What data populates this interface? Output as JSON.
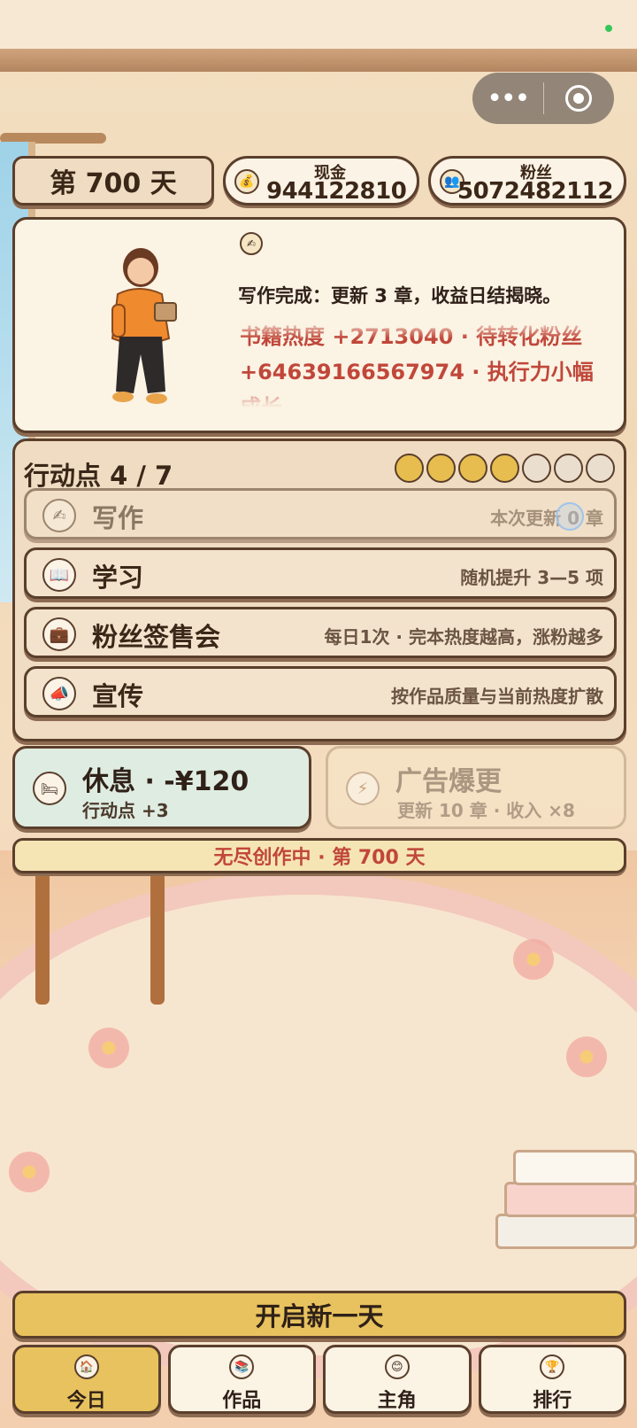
{
  "status": {
    "day_label": "第 700 天"
  },
  "stats": {
    "cash": {
      "label": "现金",
      "value": "944122810",
      "icon": "money-bag-icon"
    },
    "fans": {
      "label": "粉丝",
      "value": "5072482112",
      "icon": "people-icon"
    }
  },
  "story": {
    "icon": "quill-icon",
    "message": "写作完成：更新 3 章，收益日结揭晓。",
    "log_lines": [
      "书籍热度 +2713040 · 待转化粉丝",
      "+64639166567974 · 执行力小幅",
      "成长"
    ]
  },
  "actions": {
    "title": "行动点 4 / 7",
    "points_current": 4,
    "points_max": 7,
    "items": [
      {
        "name": "写作",
        "desc": "本次更新 0 章",
        "icon": "pen-icon",
        "enabled": false
      },
      {
        "name": "学习",
        "desc": "随机提升 3—5 项",
        "icon": "book-icon",
        "enabled": true
      },
      {
        "name": "粉丝签售会",
        "desc": "每日1次 · 完本热度越高，涨粉越多",
        "icon": "briefcase-icon",
        "enabled": true
      },
      {
        "name": "宣传",
        "desc": "按作品质量与当前热度扩散",
        "icon": "megaphone-icon",
        "enabled": true
      }
    ]
  },
  "rest": {
    "title": "休息 · -¥120",
    "subtitle": "行动点 +3",
    "icon": "bed-icon"
  },
  "ad": {
    "title": "广告爆更",
    "subtitle": "更新 10 章 · 收入 ×8",
    "icon": "lightning-icon"
  },
  "banner": {
    "text": "无尽创作中 · 第 700 天"
  },
  "new_day_button": "开启新一天",
  "tabs": [
    {
      "label": "今日",
      "icon": "house-icon",
      "active": true
    },
    {
      "label": "作品",
      "icon": "books-icon",
      "active": false
    },
    {
      "label": "主角",
      "icon": "face-icon",
      "active": false
    },
    {
      "label": "排行",
      "icon": "trophy-icon",
      "active": false
    }
  ],
  "colors": {
    "accent": "#e8c25e",
    "border": "#5a3f2c",
    "highlight_red": "#c0473a",
    "rest_bg": "#dfece2"
  }
}
